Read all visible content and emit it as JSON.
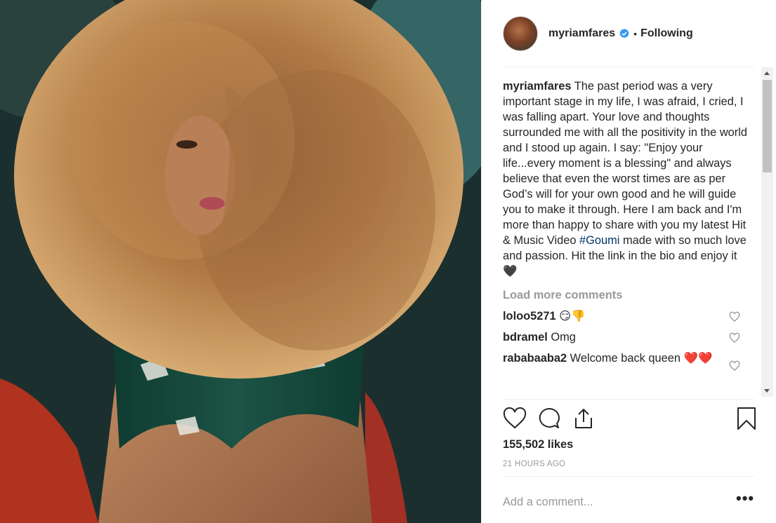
{
  "post": {
    "username": "myriamfares",
    "follow_state": "Following",
    "separator": "•",
    "caption_user": "myriamfares",
    "caption_text_1": " The past period was a very important stage in my life, I was afraid, I cried, I was falling apart. Your love and thoughts surrounded me with all the positivity in the world and I stood up again. I say: \"Enjoy your life...every moment is a blessing\" and always believe that even the worst times are as per God’s will for your own good and he will guide you to make it through. Here I am back and I'm more than happy to share with you my latest Hit & Music Video ",
    "hashtag": "#Goumi",
    "caption_text_2": " made with so much love and passion. Hit the link in the bio and enjoy it ",
    "caption_emoji": "🖤",
    "load_more": "Load more comments",
    "comments": [
      {
        "user": "loloo5271",
        "text": "",
        "emoji": "😏👎"
      },
      {
        "user": "bdramel",
        "text": " Omg",
        "emoji": ""
      },
      {
        "user": "rababaaba2",
        "text": " Welcome back queen ",
        "emoji": "❤️❤️"
      }
    ],
    "likes": "155,502 likes",
    "time": "21 HOURS AGO",
    "add_comment_placeholder": "Add a comment...",
    "more": "•••"
  },
  "colors": {
    "verified": "#3897f0",
    "hashtag": "#003569",
    "muted": "#999999",
    "text": "#262626"
  },
  "icons": [
    "verified-badge-icon",
    "heart-icon",
    "comment-icon",
    "share-icon",
    "bookmark-icon",
    "more-options-icon"
  ]
}
